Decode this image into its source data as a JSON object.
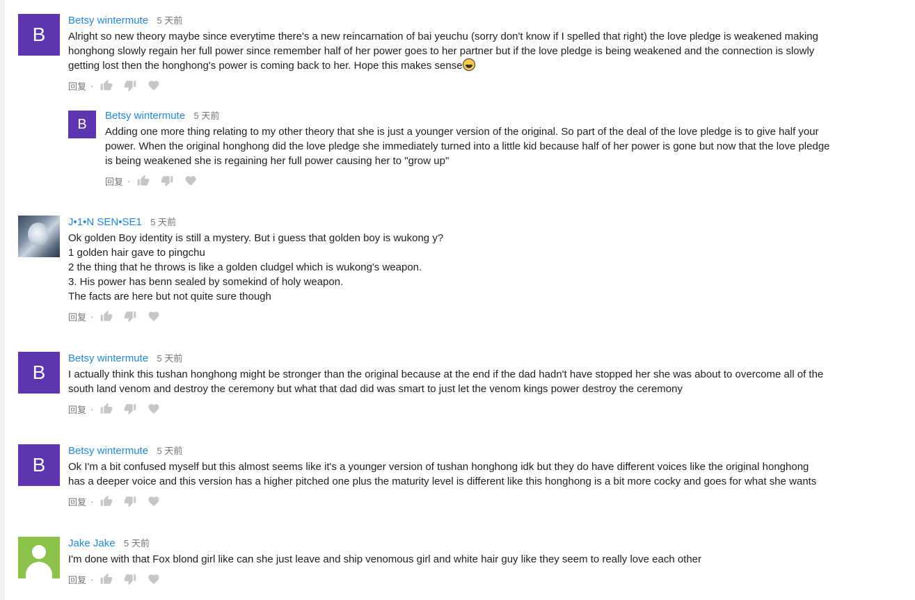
{
  "actions": {
    "reply_label": "回复",
    "separator": "·"
  },
  "comments": [
    {
      "author": "Betsy wintermute",
      "time": "5 天前",
      "avatar_letter": "B",
      "lines": [
        "Alright so new theory maybe since everytime there's a new reincarnation of bai yeuchu (sorry don't know if I spelled that right) the love pledge is weakened making",
        "honghong slowly regain her full power since remember half of her power goes to her partner but if the love pledge is being weakened and the connection is slowly",
        "getting lost then the honghong's power is coming back to her. Hope this makes sense"
      ],
      "reply": {
        "author": "Betsy wintermute",
        "time": "5 天前",
        "avatar_letter": "B",
        "lines": [
          "Adding one more thing relating to my other theory that she is just a younger version of the original. So part of the deal of the love pledge is to give half your",
          "power. When the original honghong did the love pledge she immediately turned into a little kid because half of her power is gone but now that the love pledge",
          "is being weakened she is regaining her full power causing her to \"grow up\""
        ]
      }
    },
    {
      "author": "J•1•N SEN•SE1",
      "time": "5 天前",
      "lines": [
        "Ok golden Boy identity is still a mystery. But i guess that golden boy is wukong y?",
        "1 golden hair gave to pingchu",
        "2 the thing that he throws is like a golden cludgel which is wukong's weapon.",
        "3. His power has benn sealed by somekind of holy weapon.",
        "The facts are here but not quite sure though"
      ]
    },
    {
      "author": "Betsy wintermute",
      "time": "5 天前",
      "avatar_letter": "B",
      "lines": [
        "I actually think this tushan honghong might be stronger than the original because at the end if the dad hadn't have stopped her she was about to overcome all of the",
        "south land venom and destroy the ceremony but what that dad did was smart to just let the venom kings power destroy the ceremony"
      ]
    },
    {
      "author": "Betsy wintermute",
      "time": "5 天前",
      "avatar_letter": "B",
      "lines": [
        "Ok I'm a bit confused myself but this almost seems like it's a younger version of tushan honghong idk but they do have different voices like the original honghong",
        "has a deeper voice and this version has a higher pitched one plus the maturity level is different like this honghong is a bit more cocky and goes for what she wants"
      ]
    },
    {
      "author": "Jake Jake",
      "time": "5 天前",
      "lines": [
        "I'm done with that Fox blond girl like can she just leave and ship venomous girl and white hair guy like they seem to really love each other"
      ]
    }
  ]
}
